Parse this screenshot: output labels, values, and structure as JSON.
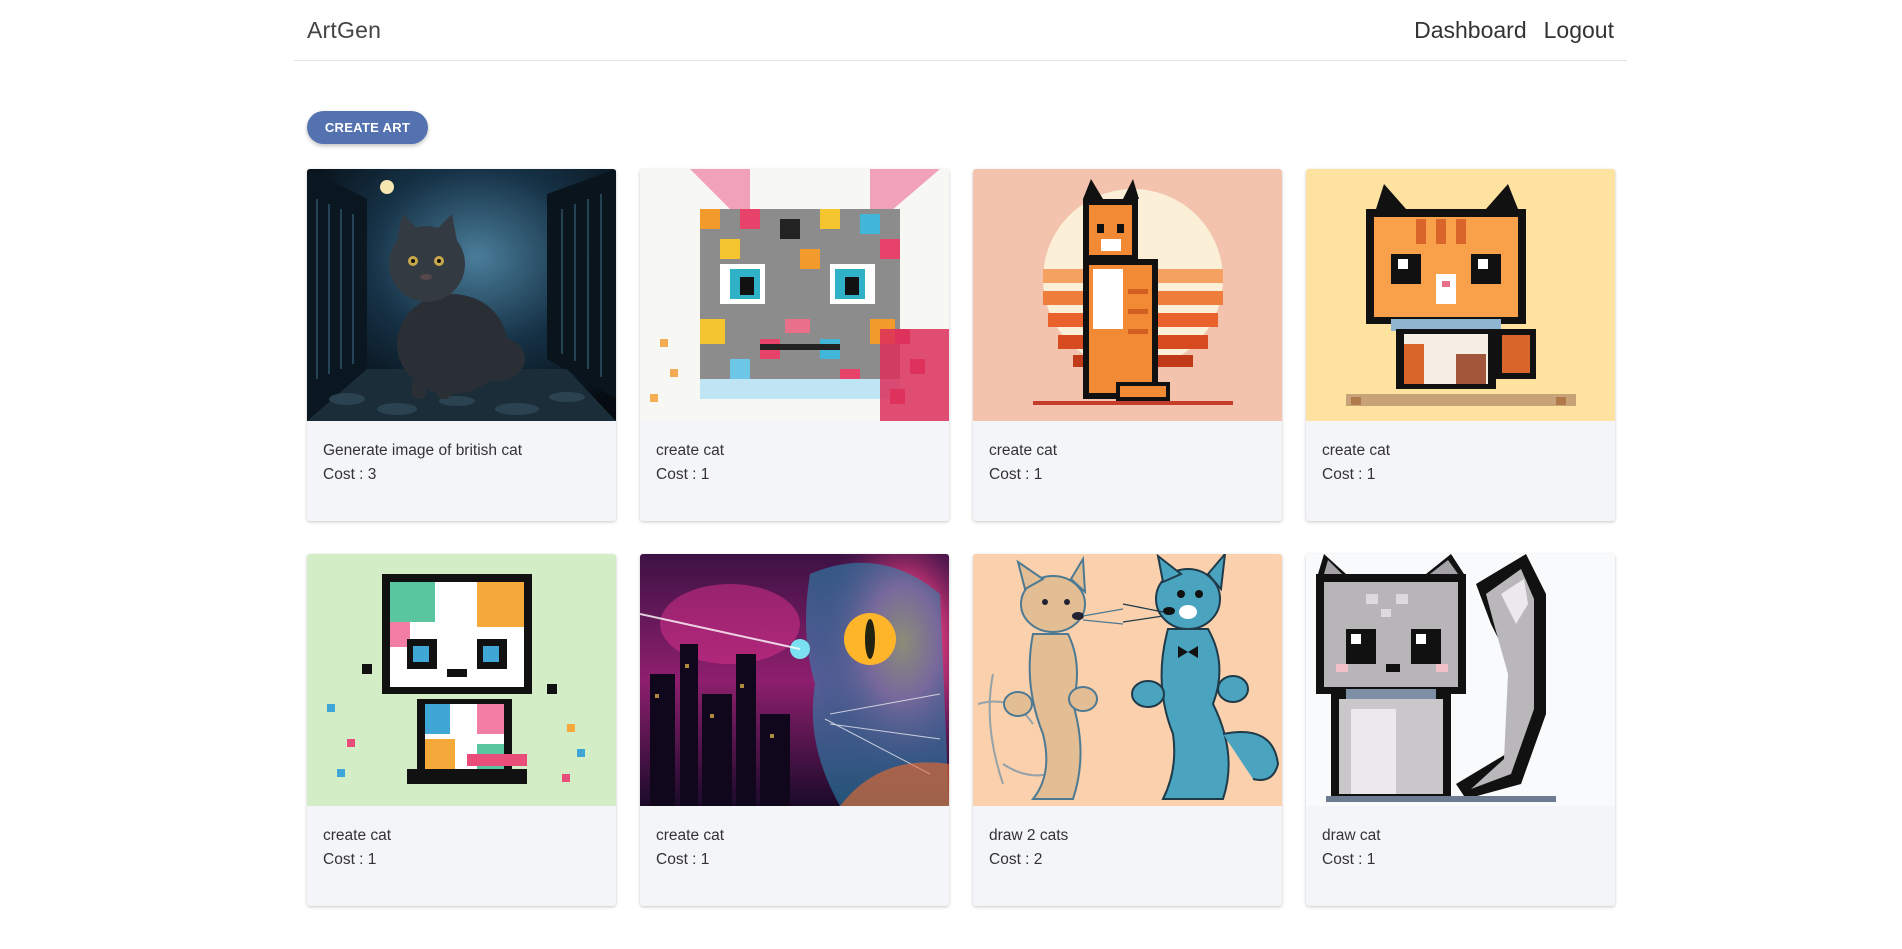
{
  "header": {
    "brand": "ArtGen",
    "nav": [
      {
        "label": "Dashboard"
      },
      {
        "label": "Logout"
      }
    ]
  },
  "actions": {
    "create_label": "CREATE ART"
  },
  "cost_prefix": "Cost : ",
  "cards": [
    {
      "title": "Generate image of british cat",
      "cost": "3",
      "image": "dark alley british cat",
      "bg": "#0d1c27"
    },
    {
      "title": "create cat",
      "cost": "1",
      "image": "pixel colorful cat face",
      "bg": "#f7f7f3"
    },
    {
      "title": "create cat",
      "cost": "1",
      "image": "pixel orange cat sunset",
      "bg": "#f3c3ad"
    },
    {
      "title": "create cat",
      "cost": "1",
      "image": "pixel kitten yellow",
      "bg": "#fde39f"
    },
    {
      "title": "create cat",
      "cost": "1",
      "image": "pixel rainbow kitten",
      "bg": "#d3edc7"
    },
    {
      "title": "create cat",
      "cost": "1",
      "image": "neon cyberpunk cat",
      "bg": "#27113a"
    },
    {
      "title": "draw 2 cats",
      "cost": "2",
      "image": "cartoon two cats sketch",
      "bg": "#fbd0ac"
    },
    {
      "title": "draw cat",
      "cost": "1",
      "image": "pixel grey cat",
      "bg": "#f9fafc"
    }
  ]
}
